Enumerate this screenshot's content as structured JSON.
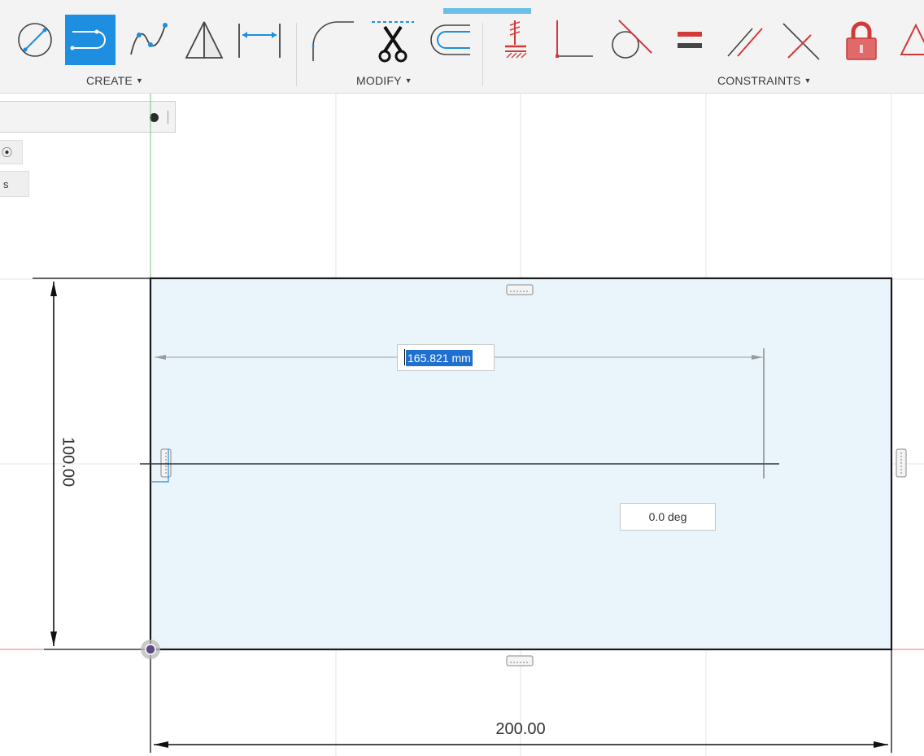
{
  "toolbar": {
    "groups": {
      "create": {
        "label": "CREATE"
      },
      "modify": {
        "label": "MODIFY"
      },
      "constraints": {
        "label": "CONSTRAINTS"
      }
    },
    "create_tools": [
      "line-circle-tool",
      "slot-tool",
      "spline-tool",
      "mirror-tool",
      "dimension-tool"
    ],
    "modify_tools": [
      "fillet-tool",
      "trim-tool",
      "offset-tool"
    ],
    "constraint_tools": [
      "fix-ground-tool",
      "perpendicular-tool",
      "tangent-tool",
      "equal-tool",
      "parallel-tool",
      "collinear-tool",
      "lock-tool",
      "triangle-tool"
    ],
    "active_tool": "slot-tool"
  },
  "palette": {
    "chip_1": "⦿",
    "chip_2": "s"
  },
  "sketch": {
    "length_value": "165.821 mm",
    "angle_value": "0.0 deg",
    "dim_height": "100.00",
    "dim_width": "200.00"
  },
  "colors": {
    "accent": "#1e8ee0",
    "constraint_red": "#d23a3a",
    "profile_fill": "#eaf4fb",
    "sketch_line": "#1a1a1a",
    "axis_green": "#7bbf7b",
    "axis_red": "#e07a7a"
  }
}
